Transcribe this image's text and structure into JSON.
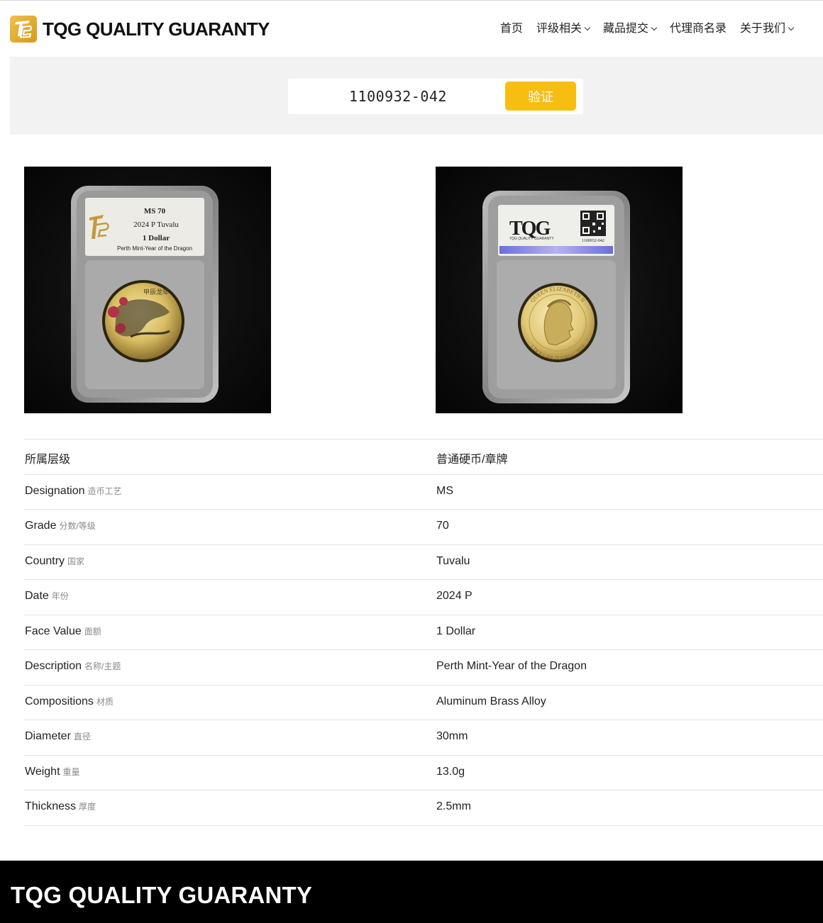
{
  "header": {
    "brand": "TQG QUALITY GUARANTY",
    "nav": [
      {
        "label": "首页",
        "dropdown": false
      },
      {
        "label": "评级相关",
        "dropdown": true
      },
      {
        "label": "藏品提交",
        "dropdown": true
      },
      {
        "label": "代理商名录",
        "dropdown": false
      },
      {
        "label": "关于我们",
        "dropdown": true
      }
    ]
  },
  "search": {
    "value": "1100932-042",
    "button_label": "验证"
  },
  "photos": {
    "obverse": {
      "slab_label_lines": [
        "MS 70",
        "2024 P Tuvalu",
        "1 Dollar",
        "Perth Mint-Year of the Dragon"
      ],
      "coin_text": "甲辰龙年"
    },
    "reverse": {
      "brand": "TQG",
      "brand_sub": "TQG QUALITY GUARANTY",
      "cert_number": "1100932-042",
      "coin_legend_top": "QUEEN ELIZABETH II",
      "coin_legend_bottom": "1 DOLLAR TUVALU 2024"
    }
  },
  "spec": {
    "rows": [
      {
        "label": "所属层级",
        "sub": "",
        "value": "普通硬币/章牌"
      },
      {
        "label": "Designation",
        "sub": "造币工艺",
        "value": "MS"
      },
      {
        "label": "Grade",
        "sub": "分数/等级",
        "value": "70"
      },
      {
        "label": "Country",
        "sub": "国家",
        "value": "Tuvalu"
      },
      {
        "label": "Date",
        "sub": "年份",
        "value": "2024 P"
      },
      {
        "label": "Face Value",
        "sub": "面额",
        "value": "1 Dollar"
      },
      {
        "label": "Description",
        "sub": "名称/主题",
        "value": "Perth Mint-Year of the Dragon"
      },
      {
        "label": "Compositions",
        "sub": "材质",
        "value": "Aluminum Brass Alloy"
      },
      {
        "label": "Diameter",
        "sub": "直径",
        "value": "30mm"
      },
      {
        "label": "Weight",
        "sub": "重量",
        "value": "13.0g"
      },
      {
        "label": "Thickness",
        "sub": "厚度",
        "value": "2.5mm"
      }
    ]
  },
  "footer": {
    "brand": "TQG QUALITY GUARANTY"
  },
  "colors": {
    "accent": "#f7bd11",
    "logo_gold": "#e0a82a",
    "band_bg": "#f2f2f2",
    "footer_bg": "#000000"
  }
}
